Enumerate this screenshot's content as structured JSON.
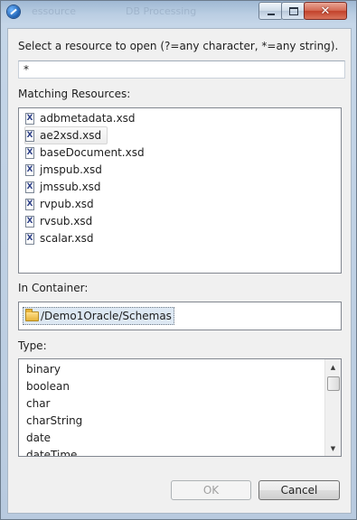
{
  "window": {
    "title_ghost_left": "essource",
    "title_ghost_right": "DB Processing"
  },
  "dialog": {
    "prompt_label": "Select a resource to open (?=any character, *=any string).",
    "pattern_value": "*",
    "matching_label": "Matching Resources:",
    "resources": [
      {
        "name": "adbmetadata.xsd",
        "icon": "xsd-file-icon",
        "selected": false
      },
      {
        "name": "ae2xsd.xsd",
        "icon": "xsd-file-icon",
        "selected": true
      },
      {
        "name": "baseDocument.xsd",
        "icon": "xsd-file-icon",
        "selected": false
      },
      {
        "name": "jmspub.xsd",
        "icon": "xsd-file-icon",
        "selected": false
      },
      {
        "name": "jmssub.xsd",
        "icon": "xsd-file-icon",
        "selected": false
      },
      {
        "name": "rvpub.xsd",
        "icon": "xsd-file-icon",
        "selected": false
      },
      {
        "name": "rvsub.xsd",
        "icon": "xsd-file-icon",
        "selected": false
      },
      {
        "name": "scalar.xsd",
        "icon": "xsd-file-icon",
        "selected": false
      }
    ],
    "file_icon_letter": "X",
    "container_label": "In Container:",
    "container_path": "/Demo1Oracle/Schemas",
    "type_label": "Type:",
    "types": [
      "binary",
      "boolean",
      "char",
      "charString",
      "date",
      "dateTime"
    ],
    "ok_label": "OK",
    "cancel_label": "Cancel",
    "close_glyph": "✕"
  }
}
